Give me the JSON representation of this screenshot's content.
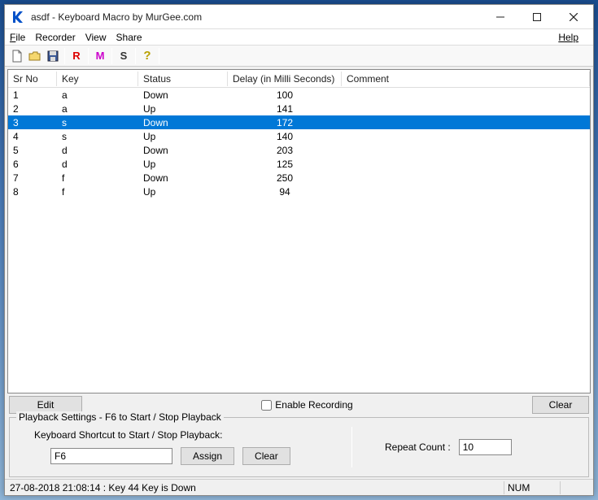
{
  "window": {
    "title": "asdf - Keyboard Macro by MurGee.com"
  },
  "menu": {
    "file": "File",
    "recorder": "Recorder",
    "view": "View",
    "share": "Share",
    "help": "Help"
  },
  "toolbar": {
    "r": "R",
    "m": "M",
    "s": "S"
  },
  "columns": {
    "srno": "Sr No",
    "key": "Key",
    "status": "Status",
    "delay": "Delay (in Milli Seconds)",
    "comment": "Comment"
  },
  "rows": [
    {
      "no": "1",
      "key": "a",
      "status": "Down",
      "delay": "100",
      "comment": "",
      "selected": false
    },
    {
      "no": "2",
      "key": "a",
      "status": "Up",
      "delay": "141",
      "comment": "",
      "selected": false
    },
    {
      "no": "3",
      "key": "s",
      "status": "Down",
      "delay": "172",
      "comment": "",
      "selected": true
    },
    {
      "no": "4",
      "key": "s",
      "status": "Up",
      "delay": "140",
      "comment": "",
      "selected": false
    },
    {
      "no": "5",
      "key": "d",
      "status": "Down",
      "delay": "203",
      "comment": "",
      "selected": false
    },
    {
      "no": "6",
      "key": "d",
      "status": "Up",
      "delay": "125",
      "comment": "",
      "selected": false
    },
    {
      "no": "7",
      "key": "f",
      "status": "Down",
      "delay": "250",
      "comment": "",
      "selected": false
    },
    {
      "no": "8",
      "key": "f",
      "status": "Up",
      "delay": "94",
      "comment": "",
      "selected": false
    }
  ],
  "buttons": {
    "edit": "Edit",
    "enable_recording": "Enable Recording",
    "clear_list": "Clear",
    "assign": "Assign",
    "clear_shortcut": "Clear"
  },
  "playback": {
    "legend": "Playback Settings - F6 to Start / Stop Playback",
    "shortcut_label": "Keyboard Shortcut to Start / Stop Playback:",
    "shortcut_value": "F6",
    "repeat_label": "Repeat Count :",
    "repeat_value": "10"
  },
  "status": {
    "text": "27-08-2018 21:08:14 : Key 44 Key is Down",
    "num": "NUM"
  }
}
